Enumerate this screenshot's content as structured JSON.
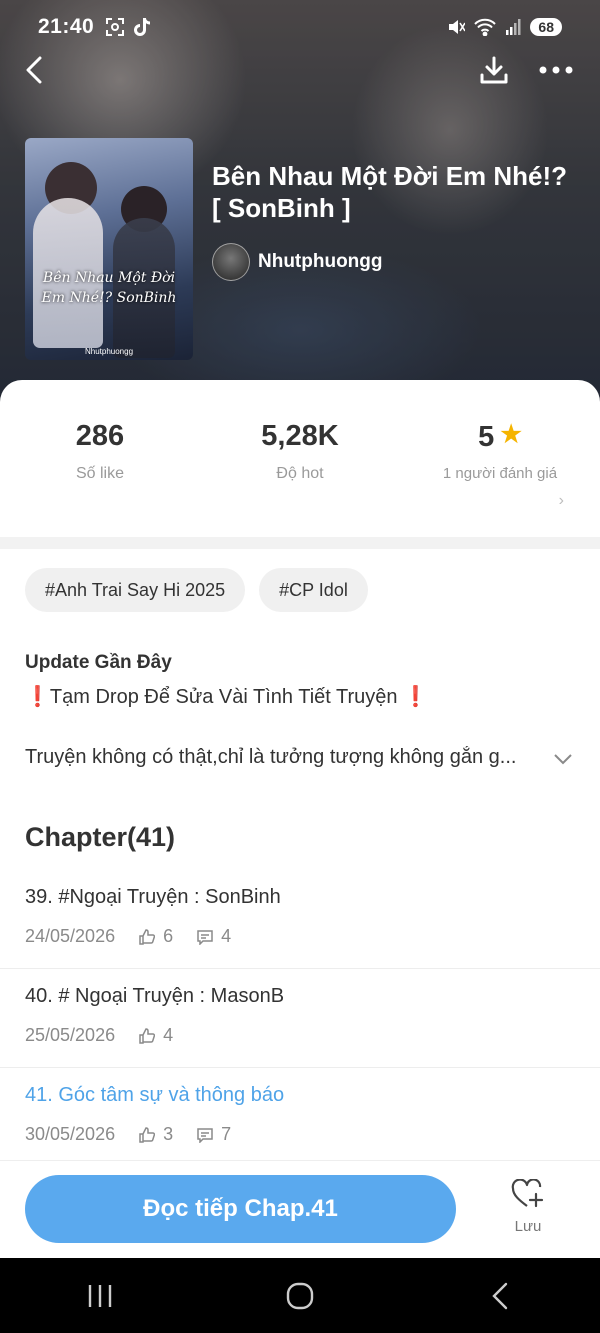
{
  "status_bar": {
    "time": "21:40",
    "battery": "68"
  },
  "book": {
    "title_line1": "Bên Nhau Một Đời Em Nhé!?",
    "title_line2": "[ SonBinh ]",
    "author": "Nhutphuongg",
    "cover_title": "Bên Nhau Một Đời Em Nhé!? SonBinh",
    "cover_author": "Nhutphuongg"
  },
  "stats": {
    "likes": {
      "value": "286",
      "label": "Số like"
    },
    "hot": {
      "value": "5,28K",
      "label": "Độ hot"
    },
    "rating": {
      "value": "5",
      "label": "1 người đánh giá"
    }
  },
  "tags": [
    "#Anh Trai Say Hi 2025",
    "#CP Idol"
  ],
  "update": {
    "title": "Update Gần Đây",
    "text": "Tạm Drop Để Sửa Vài Tình Tiết Truyện"
  },
  "description": "Truyện không có thật,chỉ là tưởng tượng không gắn g...",
  "chapters_heading": "Chapter(41)",
  "chapters": [
    {
      "title": "39. #Ngoại Truyện : SonBinh",
      "date": "24/05/2026",
      "likes": "6",
      "comments": "4"
    },
    {
      "title": "40. # Ngoại Truyện : MasonB",
      "date": "25/05/2026",
      "likes": "4"
    },
    {
      "title": "41. Góc tâm sự và thông báo",
      "date": "30/05/2026",
      "likes": "3",
      "comments": "7"
    }
  ],
  "footer": {
    "read_button": "Đọc tiếp Chap.41",
    "save_label": "Lưu"
  },
  "colors": {
    "accent": "#5aa9ee",
    "active_chapter": "#4fa3e8",
    "star": "#f5b400"
  }
}
